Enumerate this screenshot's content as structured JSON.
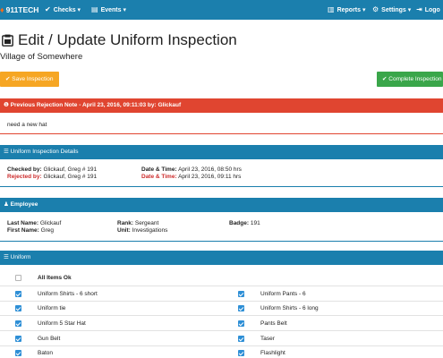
{
  "navbar": {
    "brand": "911TECH",
    "checks": "Checks",
    "events": "Events",
    "reports": "Reports",
    "settings": "Settings",
    "logout": "Logo"
  },
  "page": {
    "title": "Edit / Update Uniform Inspection",
    "subtitle": "Village of Somewhere"
  },
  "buttons": {
    "save": "Save Inspection",
    "complete": "Complete Inspection"
  },
  "rejection": {
    "header": "Previous Rejection Note - April 23, 2016, 09:11:03 by: Glickauf",
    "note": "need a new hat"
  },
  "details": {
    "header": "Uniform Inspection Details",
    "checked_by_label": "Checked by:",
    "checked_by_value": "Glickauf, Greg # 191",
    "rejected_by_label": "Rejected by:",
    "rejected_by_value": "Glickauf, Greg # 191",
    "datetime_label": "Date & Time:",
    "checked_datetime": "April 23, 2016, 08:50 hrs",
    "rejected_datetime": "April 23, 2016, 09:11 hrs"
  },
  "employee": {
    "header": "Employee",
    "last_name_label": "Last Name:",
    "last_name": "Glickauf",
    "first_name_label": "First Name:",
    "first_name": "Greg",
    "rank_label": "Rank:",
    "rank": "Sergeant",
    "unit_label": "Unit:",
    "unit": "Investigations",
    "badge_label": "Badge:",
    "badge": "191"
  },
  "uniform": {
    "header": "Uniform",
    "all_items_label": "All Items Ok",
    "all_items_checked": false,
    "rows": [
      {
        "left": "Uniform Shirts - 6 short",
        "right": "Uniform Pants - 6"
      },
      {
        "left": "Uniform tie",
        "right": "Uniform Shirts - 6 long"
      },
      {
        "left": "Uniform 5 Star Hat",
        "right": "Pants Belt"
      },
      {
        "left": "Gun Belt",
        "right": "Taser"
      },
      {
        "left": "Baton",
        "right": "Flashlight"
      }
    ]
  },
  "colors": {
    "navbar": "#1b7fad",
    "danger": "#e04530",
    "warning": "#f6a623",
    "success": "#3aa64a",
    "checkbox": "#2e8fd6"
  }
}
